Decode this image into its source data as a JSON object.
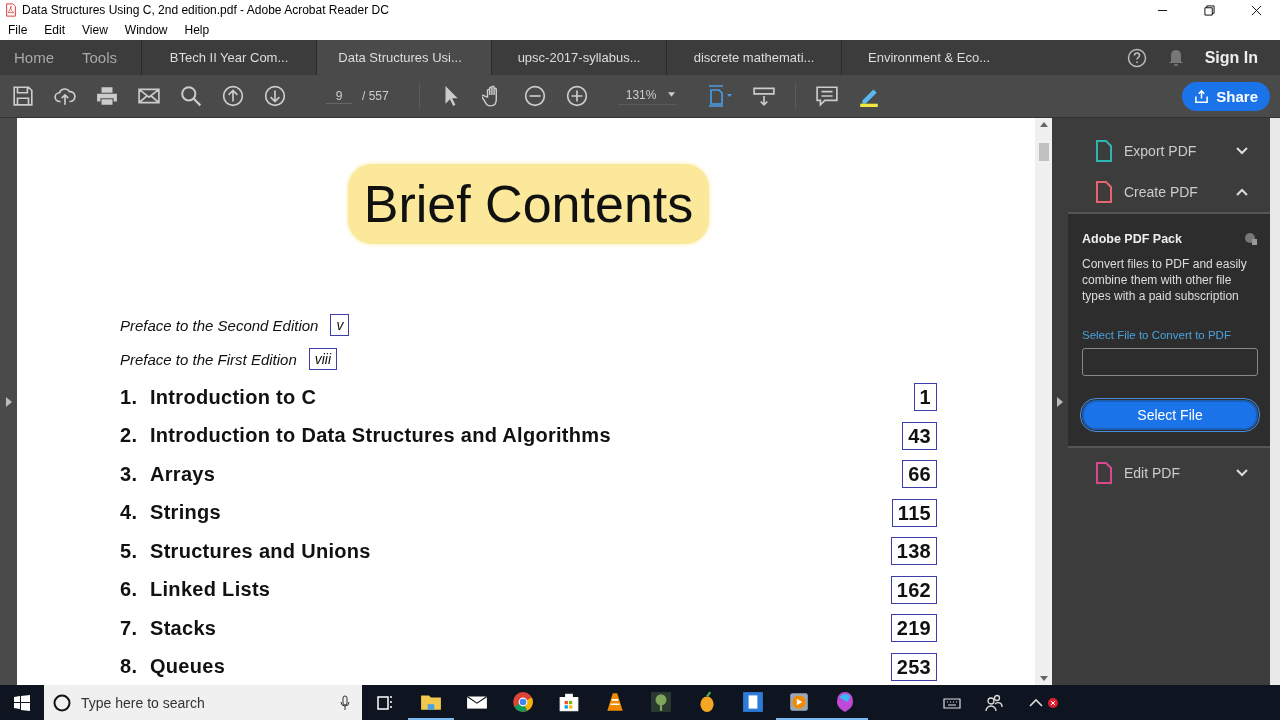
{
  "window": {
    "title": "Data Structures Using C, 2nd edition.pdf - Adobe Acrobat Reader DC"
  },
  "menu": [
    "File",
    "Edit",
    "View",
    "Window",
    "Help"
  ],
  "nav": [
    "Home",
    "Tools"
  ],
  "tabs": [
    {
      "label": "BTech II Year  Com...",
      "selected": false
    },
    {
      "label": "Data Structures Usi...",
      "selected": true
    },
    {
      "label": "upsc-2017-syllabus...",
      "selected": false
    },
    {
      "label": "discrete mathemati...",
      "selected": false
    },
    {
      "label": "Environment & Eco...",
      "selected": false
    }
  ],
  "account": {
    "sign_in": "Sign In"
  },
  "toolbar": {
    "page": "9",
    "page_total": "/ 557",
    "zoom": "131%",
    "share": "Share"
  },
  "document": {
    "heading": "Brief Contents",
    "prefaces": [
      {
        "title": "Preface to the Second Edition",
        "page": "v"
      },
      {
        "title": "Preface to the First Edition",
        "page": "viii"
      }
    ],
    "chapters": [
      {
        "number": "1.",
        "title": "Introduction to C",
        "page": "1"
      },
      {
        "number": "2.",
        "title": "Introduction to Data Structures and Algorithms",
        "page": "43"
      },
      {
        "number": "3.",
        "title": "Arrays",
        "page": "66"
      },
      {
        "number": "4.",
        "title": "Strings",
        "page": "115"
      },
      {
        "number": "5.",
        "title": "Structures and Unions",
        "page": "138"
      },
      {
        "number": "6.",
        "title": "Linked Lists",
        "page": "162"
      },
      {
        "number": "7.",
        "title": "Stacks",
        "page": "219"
      },
      {
        "number": "8.",
        "title": "Queues",
        "page": "253"
      }
    ]
  },
  "tools_panel": {
    "tools": [
      {
        "label": "Export PDF",
        "expanded": false,
        "color": "#2fb5b0"
      },
      {
        "label": "Create PDF",
        "expanded": true,
        "color": "#e8636b"
      },
      {
        "label": "Edit PDF",
        "expanded": false,
        "color": "#d9488f"
      }
    ],
    "pack_title": "Adobe PDF Pack",
    "pack_description": "Convert files to PDF and easily combine them with other file types with a paid subscription",
    "field_label": "Select File to Convert to PDF",
    "button": "Select File"
  },
  "taskbar": {
    "search_placeholder": "Type here to search",
    "apps": [
      {
        "kind": "explorer",
        "running": true
      },
      {
        "kind": "mail",
        "running": false
      },
      {
        "kind": "chrome",
        "running": false
      },
      {
        "kind": "store",
        "running": false
      },
      {
        "kind": "vlc",
        "running": false
      },
      {
        "kind": "tree",
        "running": false
      },
      {
        "kind": "fruit",
        "running": false
      },
      {
        "kind": "doc",
        "running": false
      },
      {
        "kind": "player",
        "running": true
      },
      {
        "kind": "paint",
        "running": true
      }
    ]
  }
}
